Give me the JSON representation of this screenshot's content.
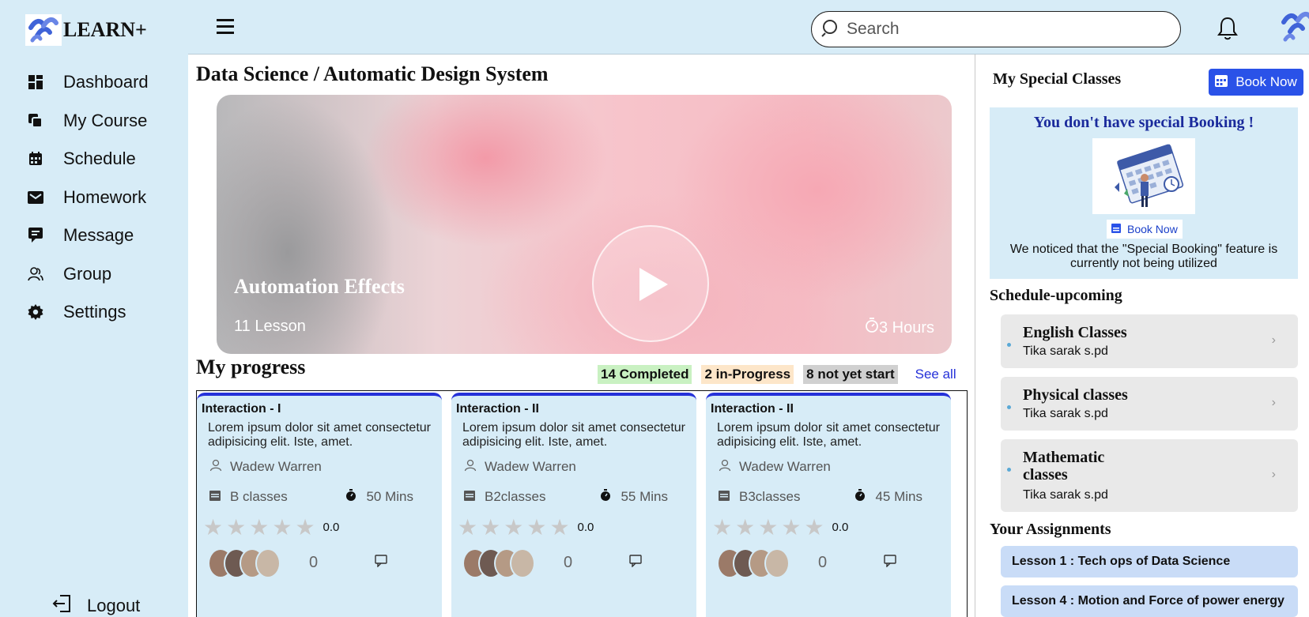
{
  "app": {
    "name": "LEARN+"
  },
  "sidebar": {
    "items": [
      {
        "label": "Dashboard",
        "icon": "grid-icon"
      },
      {
        "label": "My Course",
        "icon": "copy-icon"
      },
      {
        "label": "Schedule",
        "icon": "calendar-icon"
      },
      {
        "label": "Homework",
        "icon": "envelope-icon"
      },
      {
        "label": "Message",
        "icon": "message-icon"
      },
      {
        "label": "Group",
        "icon": "group-icon"
      },
      {
        "label": "Settings",
        "icon": "gear-icon"
      }
    ],
    "logout": "Logout"
  },
  "topbar": {
    "search_placeholder": "Search"
  },
  "main": {
    "breadcrumb": "Data Science / Automatic Design System",
    "hero": {
      "title": "Automation Effects",
      "lessons": "11 Lesson",
      "hours": "3 Hours"
    },
    "progress": {
      "title": "My progress",
      "completed": "14 Completed",
      "in_progress": "2 in-Progress",
      "not_started": "8 not yet start",
      "see_all": "See all"
    },
    "cards": [
      {
        "title": "Interaction - I",
        "desc": "Lorem ipsum dolor sit amet consectetur adipisicing elit. Iste, amet.",
        "author": "Wadew Warren",
        "class": "B classes",
        "duration": "50 Mins",
        "rating": "0.0",
        "count": "0"
      },
      {
        "title": "Interaction - II",
        "desc": "Lorem ipsum dolor sit amet consectetur adipisicing elit. Iste, amet.",
        "author": "Wadew Warren",
        "class": "B2classes",
        "duration": "55 Mins",
        "rating": "0.0",
        "count": "0"
      },
      {
        "title": "Interaction - II",
        "desc": "Lorem ipsum dolor sit amet consectetur adipisicing elit. Iste, amet.",
        "author": "Wadew Warren",
        "class": "B3classes",
        "duration": "45 Mins",
        "rating": "0.0",
        "count": "0"
      }
    ]
  },
  "right": {
    "special_title": "My Special Classes",
    "book_now": "Book Now",
    "booking": {
      "heading": "You don't have special Booking !",
      "link": "Book Now",
      "note": "We noticed that the \"Special Booking\" feature is currently not being utilized"
    },
    "schedule_title": "Schedule-upcoming",
    "schedule": [
      {
        "name": "English Classes",
        "teacher": "Tika sarak s.pd"
      },
      {
        "name": "Physical classes",
        "teacher": "Tika sarak s.pd"
      },
      {
        "name": "Mathematic classes",
        "teacher": "Tika sarak s.pd"
      }
    ],
    "assign_title": "Your Assignments",
    "assignments": [
      "Lesson 1 : Tech ops of Data Science",
      "Lesson 4 : Motion and Force of power energy"
    ]
  },
  "colors": {
    "accent": "#2531d9",
    "sidebar_bg": "#d7ecf7",
    "book_button": "#2a52e8"
  }
}
